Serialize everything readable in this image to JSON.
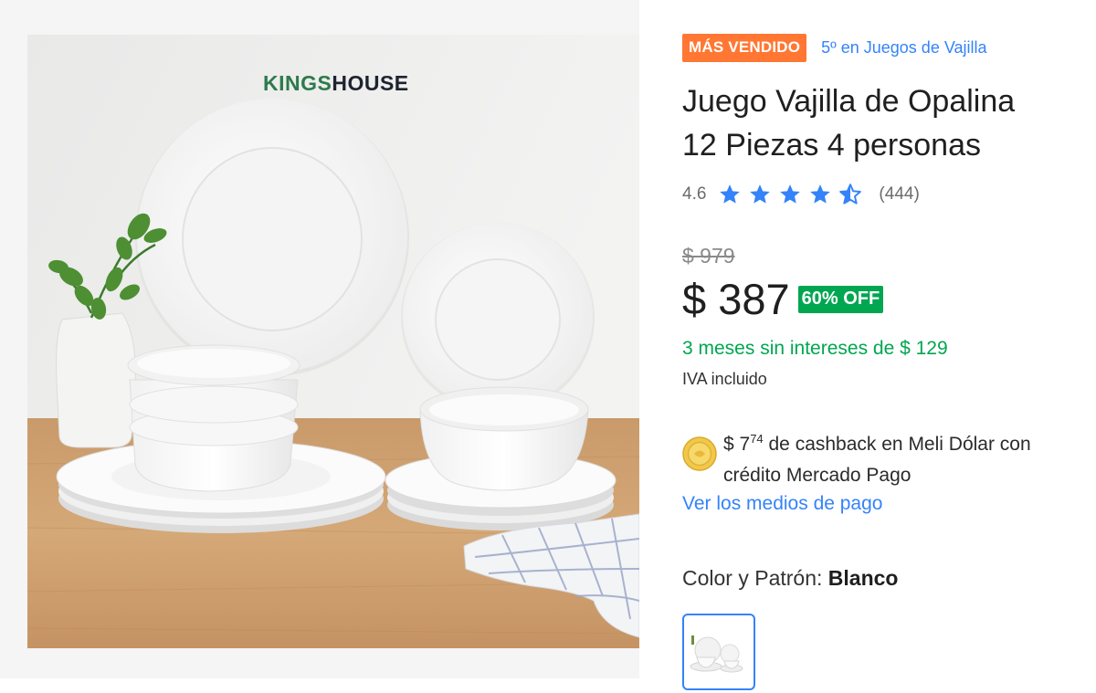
{
  "gallery": {
    "image_alt": "Juego de vajilla blanca de opalina sobre mesa de madera",
    "brand_part1": "KINGS",
    "brand_part2": "HOUSE"
  },
  "product": {
    "badge": "MÁS VENDIDO",
    "ranking": "5º en Juegos de Vajilla",
    "title_line1": "Juego Vajilla de Opalina",
    "title_line2": "12 Piezas 4 personas",
    "rating": "4.6",
    "rating_value": 4.6,
    "stars_icon": "star-icon",
    "review_count": "(444)",
    "old_price": "$ 979",
    "price": "$ 387",
    "discount": "60% OFF",
    "installments": "3 meses sin intereses de $ 129",
    "tax_note": "IVA incluido",
    "cashback_amount": "$ 7",
    "cashback_cents": "74",
    "cashback_text_1": " de cashback en Meli Dólar con",
    "cashback_text_2": "crédito Mercado Pago",
    "payment_link": "Ver los medios de pago",
    "variant_label": "Color y Patrón: ",
    "variant_value": "Blanco"
  },
  "colors": {
    "accent_blue": "#3483fa",
    "badge_orange": "#ff7733",
    "discount_green": "#00a650"
  }
}
